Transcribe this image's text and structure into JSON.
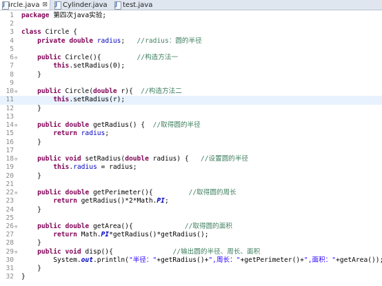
{
  "tabs": [
    {
      "label": "Circle.java",
      "close": "⊠",
      "active": true
    },
    {
      "label": "Cylinder.java",
      "active": false
    },
    {
      "label": "test.java",
      "active": false
    }
  ],
  "editor": {
    "current_line": 11,
    "lines": [
      {
        "n": 1,
        "segs": [
          {
            "t": "kw",
            "v": "package"
          },
          {
            "t": "plain",
            "v": " 第四次java实验;"
          }
        ]
      },
      {
        "n": 2,
        "segs": []
      },
      {
        "n": 3,
        "segs": [
          {
            "t": "kw",
            "v": "class"
          },
          {
            "t": "plain",
            "v": " Circle {"
          }
        ]
      },
      {
        "n": 4,
        "segs": [
          {
            "t": "plain",
            "v": "    "
          },
          {
            "t": "kw",
            "v": "private"
          },
          {
            "t": "plain",
            "v": " "
          },
          {
            "t": "kw",
            "v": "double"
          },
          {
            "t": "plain",
            "v": " "
          },
          {
            "t": "fld",
            "v": "radius"
          },
          {
            "t": "plain",
            "v": ";   "
          },
          {
            "t": "cmt",
            "v": "//radius：圆的半径"
          }
        ]
      },
      {
        "n": 5,
        "segs": []
      },
      {
        "n": 6,
        "fold": "⊖",
        "segs": [
          {
            "t": "plain",
            "v": "    "
          },
          {
            "t": "kw",
            "v": "public"
          },
          {
            "t": "plain",
            "v": " Circle(){         "
          },
          {
            "t": "cmt",
            "v": "//构造方法一"
          }
        ]
      },
      {
        "n": 7,
        "segs": [
          {
            "t": "plain",
            "v": "        "
          },
          {
            "t": "kw",
            "v": "this"
          },
          {
            "t": "plain",
            "v": ".setRadius(0);"
          }
        ]
      },
      {
        "n": 8,
        "segs": [
          {
            "t": "plain",
            "v": "    }"
          }
        ]
      },
      {
        "n": 9,
        "segs": []
      },
      {
        "n": 10,
        "fold": "⊖",
        "segs": [
          {
            "t": "plain",
            "v": "    "
          },
          {
            "t": "kw",
            "v": "public"
          },
          {
            "t": "plain",
            "v": " Circle("
          },
          {
            "t": "kw",
            "v": "double"
          },
          {
            "t": "plain",
            "v": " r){  "
          },
          {
            "t": "cmt",
            "v": "//构造方法二"
          }
        ]
      },
      {
        "n": 11,
        "segs": [
          {
            "t": "plain",
            "v": "        "
          },
          {
            "t": "kw",
            "v": "this"
          },
          {
            "t": "plain",
            "v": ".setRadius(r);"
          }
        ]
      },
      {
        "n": 12,
        "segs": [
          {
            "t": "plain",
            "v": "    }"
          }
        ]
      },
      {
        "n": 13,
        "segs": []
      },
      {
        "n": 14,
        "fold": "⊖",
        "segs": [
          {
            "t": "plain",
            "v": "    "
          },
          {
            "t": "kw",
            "v": "public"
          },
          {
            "t": "plain",
            "v": " "
          },
          {
            "t": "kw",
            "v": "double"
          },
          {
            "t": "plain",
            "v": " getRadius() {  "
          },
          {
            "t": "cmt",
            "v": "//取得圆的半径"
          }
        ]
      },
      {
        "n": 15,
        "segs": [
          {
            "t": "plain",
            "v": "        "
          },
          {
            "t": "kw",
            "v": "return"
          },
          {
            "t": "plain",
            "v": " "
          },
          {
            "t": "fld",
            "v": "radius"
          },
          {
            "t": "plain",
            "v": ";"
          }
        ]
      },
      {
        "n": 16,
        "segs": [
          {
            "t": "plain",
            "v": "    }"
          }
        ]
      },
      {
        "n": 17,
        "segs": []
      },
      {
        "n": 18,
        "fold": "⊖",
        "segs": [
          {
            "t": "plain",
            "v": "    "
          },
          {
            "t": "kw",
            "v": "public"
          },
          {
            "t": "plain",
            "v": " "
          },
          {
            "t": "kw",
            "v": "void"
          },
          {
            "t": "plain",
            "v": " setRadius("
          },
          {
            "t": "kw",
            "v": "double"
          },
          {
            "t": "plain",
            "v": " radius) {   "
          },
          {
            "t": "cmt",
            "v": "//设置圆的半径"
          }
        ]
      },
      {
        "n": 19,
        "segs": [
          {
            "t": "plain",
            "v": "        "
          },
          {
            "t": "kw",
            "v": "this"
          },
          {
            "t": "plain",
            "v": "."
          },
          {
            "t": "fld",
            "v": "radius"
          },
          {
            "t": "plain",
            "v": " = radius;"
          }
        ]
      },
      {
        "n": 20,
        "segs": [
          {
            "t": "plain",
            "v": "    }"
          }
        ]
      },
      {
        "n": 21,
        "segs": []
      },
      {
        "n": 22,
        "fold": "⊖",
        "segs": [
          {
            "t": "plain",
            "v": "    "
          },
          {
            "t": "kw",
            "v": "public"
          },
          {
            "t": "plain",
            "v": " "
          },
          {
            "t": "kw",
            "v": "double"
          },
          {
            "t": "plain",
            "v": " getPerimeter(){         "
          },
          {
            "t": "cmt",
            "v": "//取得圆的周长"
          }
        ]
      },
      {
        "n": 23,
        "segs": [
          {
            "t": "plain",
            "v": "        "
          },
          {
            "t": "kw",
            "v": "return"
          },
          {
            "t": "plain",
            "v": " getRadius()*2*Math."
          },
          {
            "t": "fldi",
            "v": "PI"
          },
          {
            "t": "plain",
            "v": ";"
          }
        ]
      },
      {
        "n": 24,
        "segs": [
          {
            "t": "plain",
            "v": "    }"
          }
        ]
      },
      {
        "n": 25,
        "segs": []
      },
      {
        "n": 26,
        "fold": "⊖",
        "segs": [
          {
            "t": "plain",
            "v": "    "
          },
          {
            "t": "kw",
            "v": "public"
          },
          {
            "t": "plain",
            "v": " "
          },
          {
            "t": "kw",
            "v": "double"
          },
          {
            "t": "plain",
            "v": " getArea(){             "
          },
          {
            "t": "cmt",
            "v": "//取得圆的面积"
          }
        ]
      },
      {
        "n": 27,
        "segs": [
          {
            "t": "plain",
            "v": "        "
          },
          {
            "t": "kw",
            "v": "return"
          },
          {
            "t": "plain",
            "v": " Math."
          },
          {
            "t": "fldi",
            "v": "PI"
          },
          {
            "t": "plain",
            "v": "*getRadius()*getRadius();"
          }
        ]
      },
      {
        "n": 28,
        "segs": [
          {
            "t": "plain",
            "v": "    }"
          }
        ]
      },
      {
        "n": 29,
        "fold": "⊖",
        "segs": [
          {
            "t": "plain",
            "v": "    "
          },
          {
            "t": "kw",
            "v": "public"
          },
          {
            "t": "plain",
            "v": " "
          },
          {
            "t": "kw",
            "v": "void"
          },
          {
            "t": "plain",
            "v": " disp(){               "
          },
          {
            "t": "cmt",
            "v": "//输出圆的半径、周长、面积"
          }
        ]
      },
      {
        "n": 30,
        "segs": [
          {
            "t": "plain",
            "v": "        System."
          },
          {
            "t": "fldi",
            "v": "out"
          },
          {
            "t": "plain",
            "v": ".println("
          },
          {
            "t": "str",
            "v": "\"半径：\""
          },
          {
            "t": "plain",
            "v": "+getRadius()+"
          },
          {
            "t": "str",
            "v": "\",周长：\""
          },
          {
            "t": "plain",
            "v": "+getPerimeter()+"
          },
          {
            "t": "str",
            "v": "\",面积：\""
          },
          {
            "t": "plain",
            "v": "+getArea());"
          }
        ]
      },
      {
        "n": 31,
        "segs": [
          {
            "t": "plain",
            "v": "    }"
          }
        ]
      },
      {
        "n": 32,
        "segs": [
          {
            "t": "plain",
            "v": "}"
          }
        ]
      }
    ]
  }
}
